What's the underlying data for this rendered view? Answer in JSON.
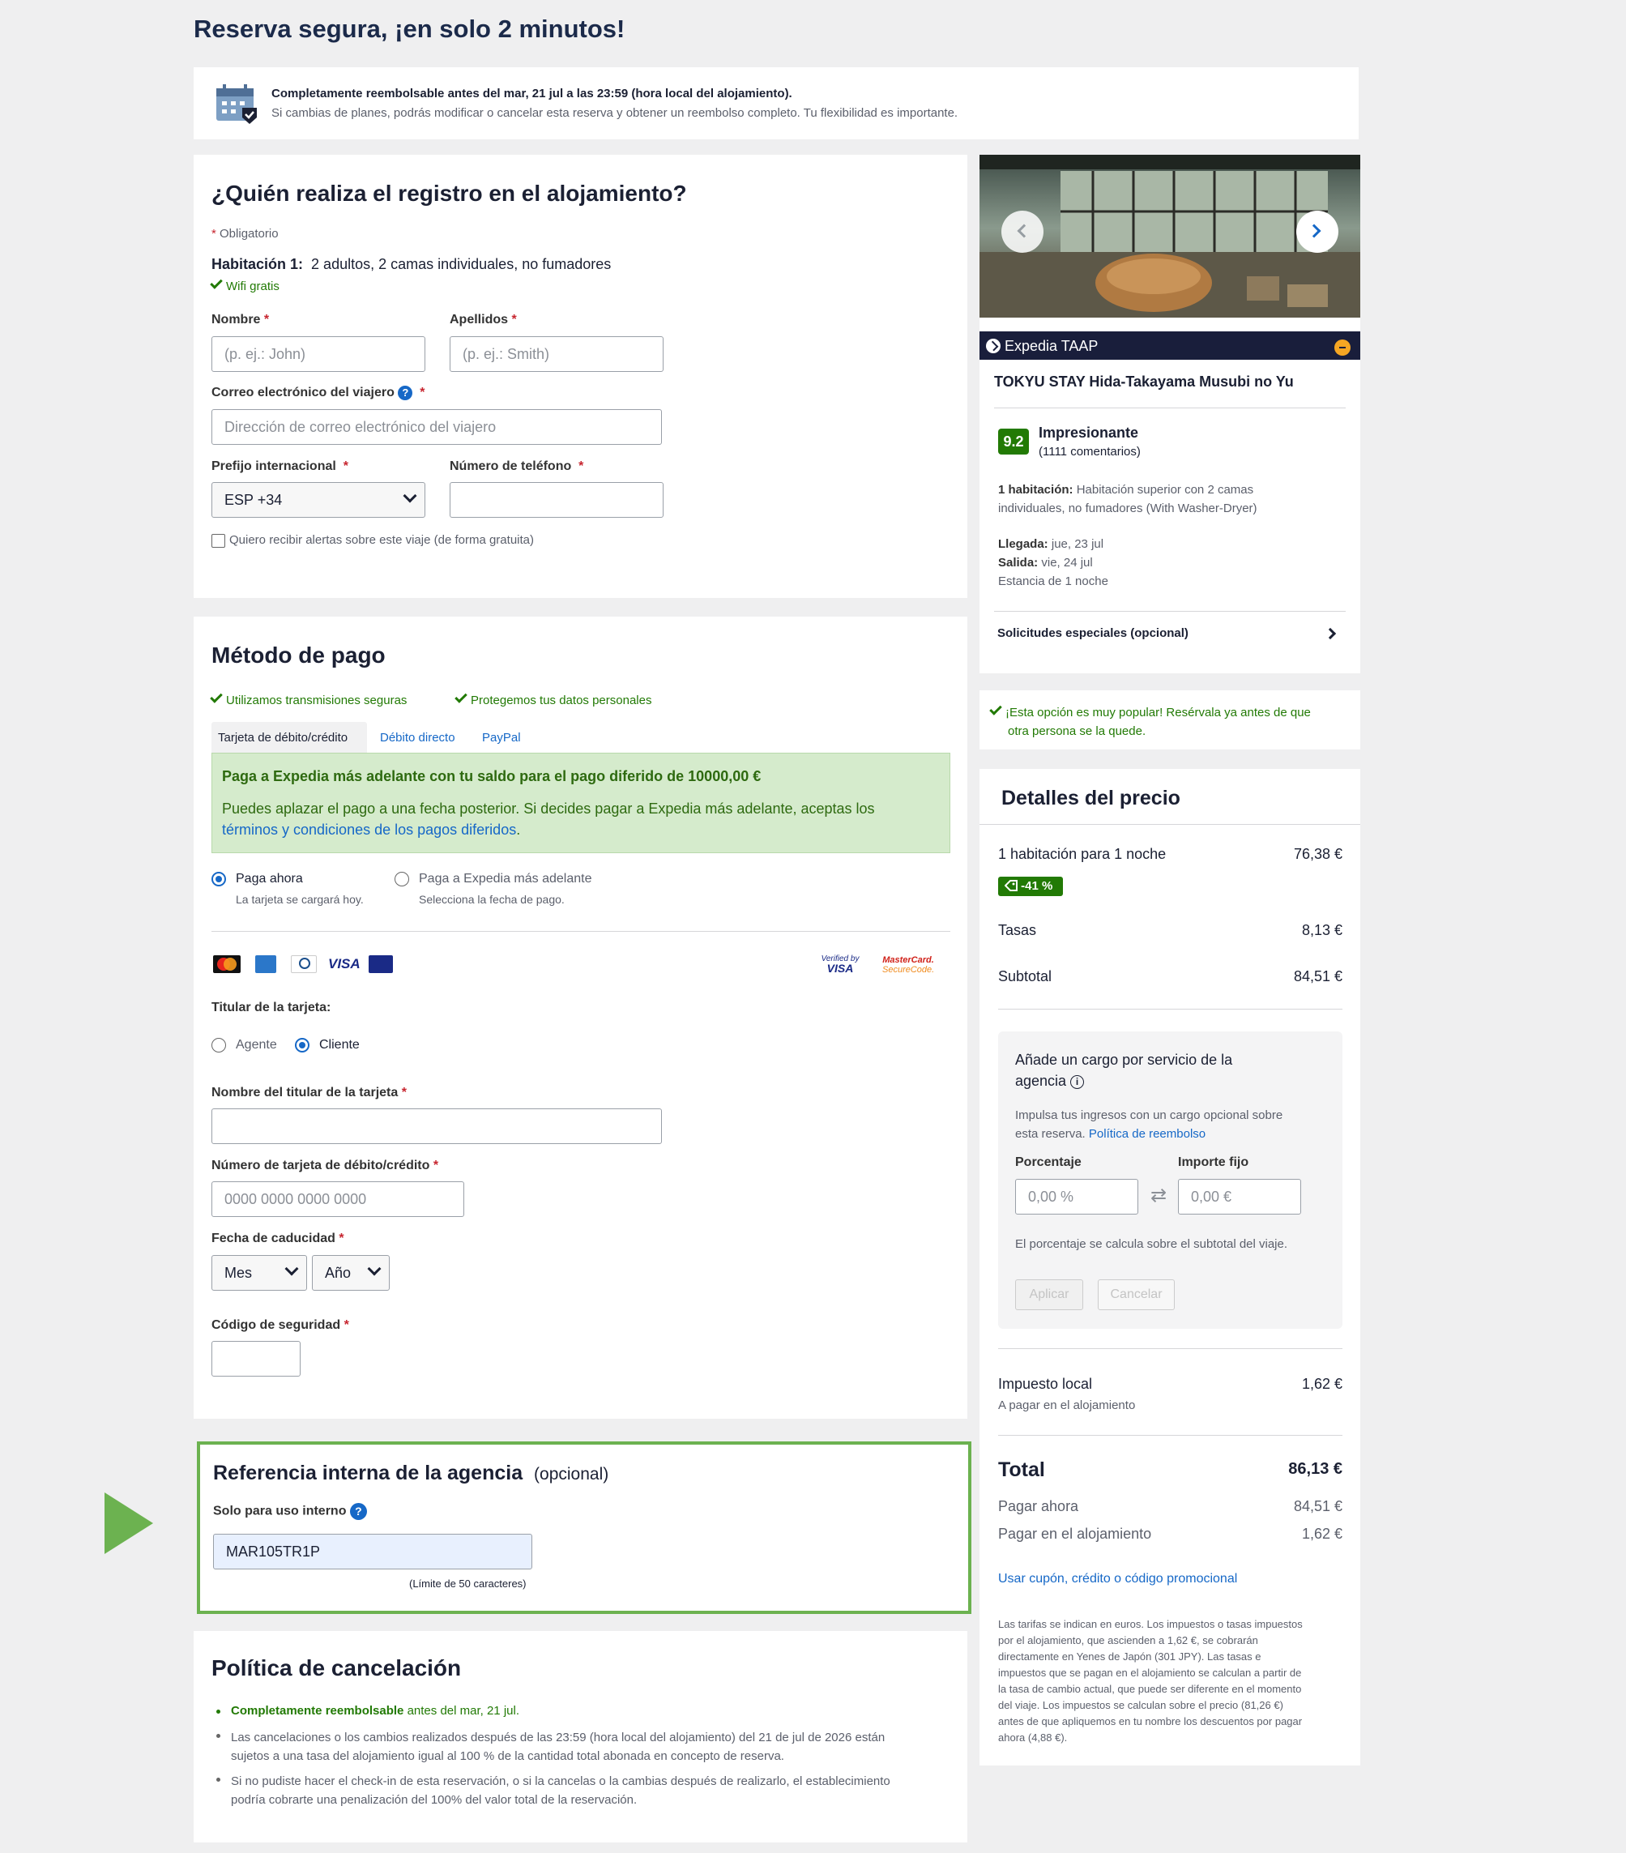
{
  "page_title": "Reserva segura, ¡en solo 2 minutos!",
  "refund_banner": {
    "bold": "Completamente reembolsable antes del mar, 21 jul a las 23:59 (hora local del alojamiento).",
    "text": "Si cambias de planes, podrás modificar o cancelar esta reserva y obtener un reembolso completo. Tu flexibilidad es importante."
  },
  "guest": {
    "title": "¿Quién realiza el registro en el alojamiento?",
    "required_note": "Obligatorio",
    "room_label": "Habitación 1:",
    "room_desc": "2 adultos, 2 camas individuales, no fumadores",
    "wifi": "Wifi gratis",
    "first_name_label": "Nombre",
    "first_name_placeholder": "(p. ej.: John)",
    "last_name_label": "Apellidos",
    "last_name_placeholder": "(p. ej.: Smith)",
    "email_label": "Correo electrónico del viajero",
    "email_placeholder": "Dirección de correo electrónico del viajero",
    "prefix_label": "Prefijo internacional",
    "prefix_value": "ESP +34",
    "phone_label": "Número de teléfono",
    "alerts_label": "Quiero recibir alertas sobre este viaje (de forma gratuita)"
  },
  "payment": {
    "title": "Método de pago",
    "secure1": "Utilizamos transmisiones seguras",
    "secure2": "Protegemos tus datos personales",
    "tabs": [
      "Tarjeta de débito/crédito",
      "Débito directo",
      "PayPal"
    ],
    "deferred_title": "Paga a Expedia más adelante con tu saldo para el pago diferido de 10000,00 €",
    "deferred_text": "Puedes aplazar el pago a una fecha posterior. Si decides pagar a Expedia más adelante, aceptas los",
    "deferred_link": "términos y condiciones de los pagos diferidos",
    "pay_now": "Paga ahora",
    "pay_now_sub": "La tarjeta se cargará hoy.",
    "pay_later": "Paga a Expedia más adelante",
    "pay_later_sub": "Selecciona la fecha de pago.",
    "card_brands": [
      "mastercard",
      "amex",
      "diners",
      "VISA",
      "visa-electron"
    ],
    "verified_visa_line1": "Verified by",
    "verified_visa_line2": "VISA",
    "mc_secure_line1": "MasterCard.",
    "mc_secure_line2": "SecureCode.",
    "holder_label": "Titular de la tarjeta:",
    "holder_agent": "Agente",
    "holder_client": "Cliente",
    "cardholder_name_label": "Nombre del titular de la tarjeta",
    "card_number_label": "Número de tarjeta de débito/crédito",
    "card_number_placeholder": "0000 0000 0000 0000",
    "expiry_label": "Fecha de caducidad",
    "month": "Mes",
    "year": "Año",
    "cvv_label": "Código de seguridad"
  },
  "agency_ref": {
    "title": "Referencia interna de la agencia",
    "optional": "(opcional)",
    "internal_label": "Solo para uso interno",
    "value": "MAR105TR1P",
    "limit": "(Límite de 50 caracteres)"
  },
  "cancellation": {
    "title": "Política de cancelación",
    "item1_bold": "Completamente reembolsable",
    "item1_rest": "antes del mar, 21 jul.",
    "item2_l1": "Las cancelaciones o los cambios realizados después de las 23:59 (hora local del alojamiento) del 21 de jul de 2026 están",
    "item2_l2": "sujetos a una tasa del alojamiento igual al 100 % de la cantidad total abonada en concepto de reserva.",
    "item3_l1": "Si no pudiste hacer el check-in de esta reservación, o si la cancelas o la cambias después de realizarlo, el establecimiento",
    "item3_l2": "podría cobrarte una penalización del 100% del valor total de la reservación."
  },
  "hotel": {
    "brand": "Expedia TAAP",
    "name": "TOKYU STAY Hida-Takayama Musubi no Yu",
    "rating": "9.2",
    "rating_word": "Impresionante",
    "reviews": "(1111 comentarios)",
    "room_bold": "1 habitación:",
    "room_l1": "Habitación superior con 2 camas",
    "room_l2": "individuales, no fumadores (With Washer-Dryer)",
    "checkin_bold": "Llegada:",
    "checkin": "jue, 23 jul",
    "checkout_bold": "Salida:",
    "checkout": "vie, 24 jul",
    "stay": "Estancia de 1 noche",
    "special_requests": "Solicitudes especiales (opcional)"
  },
  "popular": {
    "l1": "¡Esta opción es muy popular! Resérvala ya antes de que",
    "l2": "otra persona se la quede."
  },
  "price": {
    "title": "Detalles del precio",
    "room_night": "1 habitación para 1 noche",
    "room_night_value": "76,38 €",
    "discount": "-41 %",
    "taxes": "Tasas",
    "taxes_value": "8,13 €",
    "subtotal": "Subtotal",
    "subtotal_value": "84,51 €",
    "fee_title_l1": "Añade un cargo por servicio de la",
    "fee_title_l2": "agencia",
    "fee_text_l1": "Impulsa tus ingresos con un cargo opcional sobre",
    "fee_text_l2": "esta reserva.",
    "fee_link": "Política de reembolso",
    "percent_label": "Porcentaje",
    "percent_value": "0,00 %",
    "fixed_label": "Importe fijo",
    "fixed_value": "0,00 €",
    "fee_note": "El porcentaje se calcula sobre el subtotal del viaje.",
    "apply": "Aplicar",
    "cancel": "Cancelar",
    "local_tax": "Impuesto local",
    "local_tax_value": "1,62 €",
    "local_tax_sub": "A pagar en el alojamiento",
    "total": "Total",
    "total_value": "86,13 €",
    "pay_now": "Pagar ahora",
    "pay_now_value": "84,51 €",
    "pay_property": "Pagar en el alojamiento",
    "pay_property_value": "1,62 €",
    "coupon": "Usar cupón, crédito o código promocional",
    "disclaimer": [
      "Las tarifas se indican en euros. Los impuestos o tasas impuestos",
      "por el alojamiento, que ascienden a 1,62 €, se cobrarán",
      "directamente en Yenes de Japón (301 JPY). Las tasas e",
      "impuestos que se pagan en el alojamiento se calculan a partir de",
      "la tasa de cambio actual, que puede ser diferente en el momento",
      "del viaje. Los impuestos se calculan sobre el precio (81,26 €)",
      "antes de que apliquemos en tu nombre los descuentos por pagar",
      "ahora (4,88 €)."
    ]
  },
  "colors": {
    "green_check": "#227a05",
    "link_blue": "#1668c7",
    "highlight_border": "#6cb250",
    "deferred_bg": "#d5ebcc",
    "rating_bg": "#227a05"
  }
}
